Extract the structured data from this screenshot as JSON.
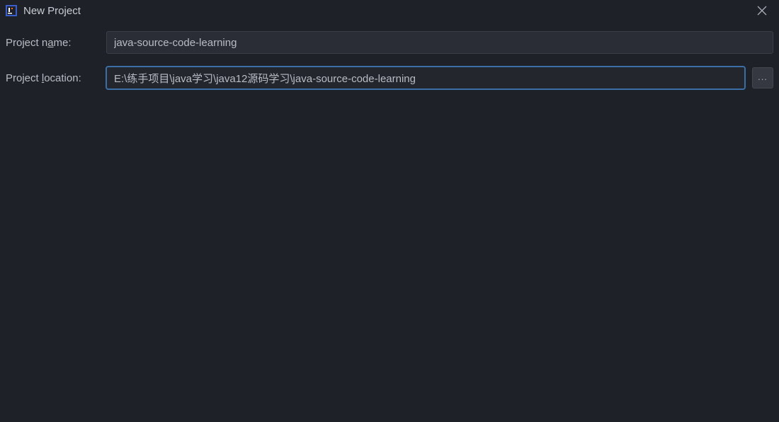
{
  "titlebar": {
    "title": "New Project"
  },
  "form": {
    "project_name": {
      "label_pre": "Project n",
      "label_mnemonic": "a",
      "label_post": "me:",
      "value": "java-source-code-learning"
    },
    "project_location": {
      "label_pre": "Project ",
      "label_mnemonic": "l",
      "label_post": "ocation:",
      "value": "E:\\练手项目\\java学习\\java12源码学习\\java-source-code-learning"
    },
    "browse_label": "..."
  }
}
